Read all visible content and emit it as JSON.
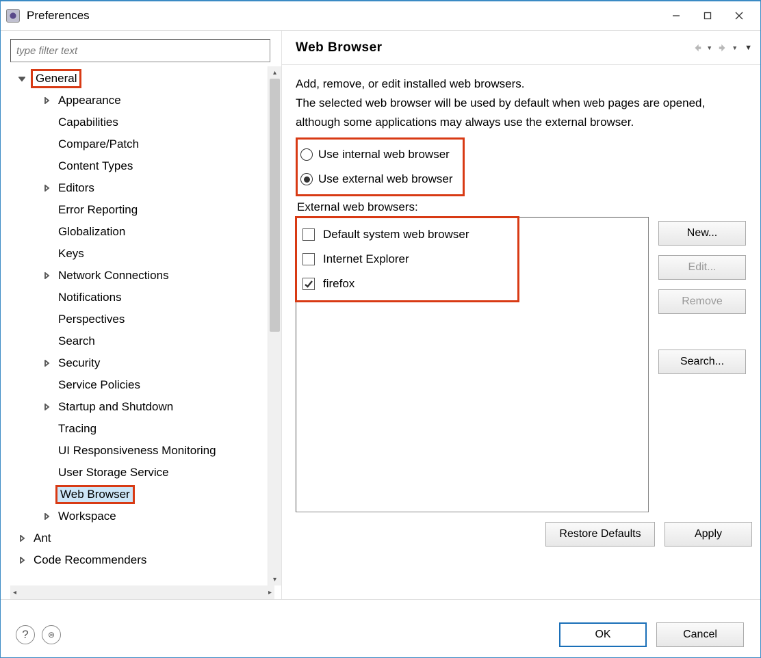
{
  "window": {
    "title": "Preferences"
  },
  "filter": {
    "placeholder": "type filter text"
  },
  "tree": {
    "items": [
      {
        "label": "General",
        "depth": 0,
        "arrow": "expanded",
        "highlighted": true
      },
      {
        "label": "Appearance",
        "depth": 1,
        "arrow": "collapsed"
      },
      {
        "label": "Capabilities",
        "depth": 1,
        "arrow": "none"
      },
      {
        "label": "Compare/Patch",
        "depth": 1,
        "arrow": "none"
      },
      {
        "label": "Content Types",
        "depth": 1,
        "arrow": "none"
      },
      {
        "label": "Editors",
        "depth": 1,
        "arrow": "collapsed"
      },
      {
        "label": "Error Reporting",
        "depth": 1,
        "arrow": "none"
      },
      {
        "label": "Globalization",
        "depth": 1,
        "arrow": "none"
      },
      {
        "label": "Keys",
        "depth": 1,
        "arrow": "none"
      },
      {
        "label": "Network Connections",
        "depth": 1,
        "arrow": "collapsed"
      },
      {
        "label": "Notifications",
        "depth": 1,
        "arrow": "none"
      },
      {
        "label": "Perspectives",
        "depth": 1,
        "arrow": "none"
      },
      {
        "label": "Search",
        "depth": 1,
        "arrow": "none"
      },
      {
        "label": "Security",
        "depth": 1,
        "arrow": "collapsed"
      },
      {
        "label": "Service Policies",
        "depth": 1,
        "arrow": "none"
      },
      {
        "label": "Startup and Shutdown",
        "depth": 1,
        "arrow": "collapsed"
      },
      {
        "label": "Tracing",
        "depth": 1,
        "arrow": "none"
      },
      {
        "label": "UI Responsiveness Monitoring",
        "depth": 1,
        "arrow": "none"
      },
      {
        "label": "User Storage Service",
        "depth": 1,
        "arrow": "none"
      },
      {
        "label": "Web Browser",
        "depth": 1,
        "arrow": "none",
        "selected": true,
        "highlighted": true
      },
      {
        "label": "Workspace",
        "depth": 1,
        "arrow": "collapsed"
      },
      {
        "label": "Ant",
        "depth": 0,
        "arrow": "collapsed"
      },
      {
        "label": "Code Recommenders",
        "depth": 0,
        "arrow": "collapsed"
      }
    ]
  },
  "page": {
    "title": "Web Browser",
    "description": "Add, remove, or edit installed web browsers.\nThe selected web browser will be used by default when web pages are opened, although some applications may always use the external browser.",
    "radios": {
      "internal": "Use internal web browser",
      "external": "Use external web browser",
      "selected": "external"
    },
    "browsers_label": "External web browsers:",
    "browsers": [
      {
        "label": "Default system web browser",
        "checked": false
      },
      {
        "label": "Internet Explorer",
        "checked": false
      },
      {
        "label": "firefox",
        "checked": true
      }
    ],
    "buttons": {
      "new": "New...",
      "edit": "Edit...",
      "remove": "Remove",
      "search": "Search...",
      "restore": "Restore Defaults",
      "apply": "Apply"
    }
  },
  "dialog_buttons": {
    "ok": "OK",
    "cancel": "Cancel"
  }
}
